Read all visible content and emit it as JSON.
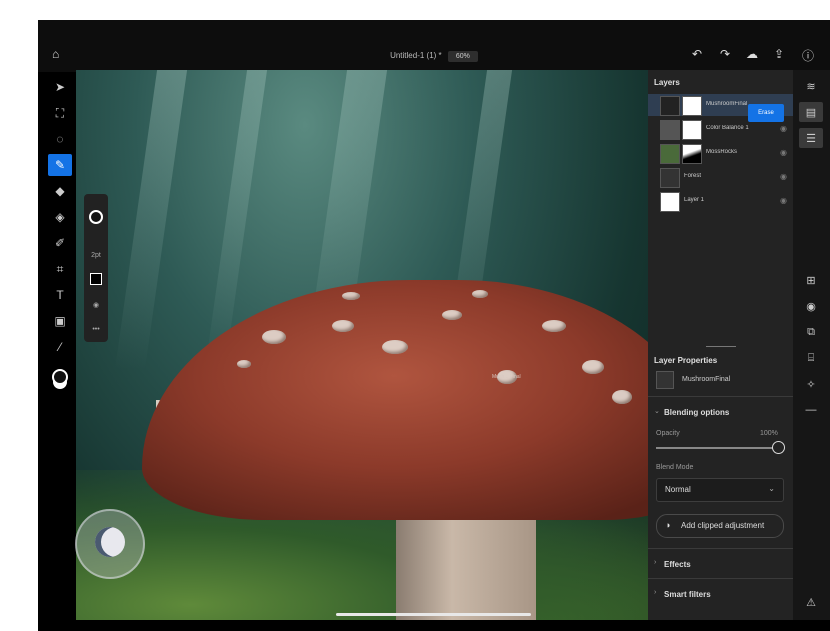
{
  "app": {
    "document_title": "Untitled-1 (1) *",
    "zoom_level": "60%"
  },
  "top_toolbar": {
    "icons": [
      "home-icon",
      "help-icon",
      "undo-icon",
      "redo-icon",
      "cloud-icon",
      "share-icon",
      "info-icon"
    ]
  },
  "left_tools": {
    "icons": [
      "move-icon",
      "crop-select-icon",
      "lasso-icon",
      "brush-icon",
      "eraser-icon",
      "fill-icon",
      "eyedropper-brush-icon",
      "transform-icon",
      "type-icon",
      "image-icon",
      "eyedropper-icon",
      "color-swatch-icon"
    ],
    "active": "brush-icon"
  },
  "brush_panel": {
    "size_label": "2pt",
    "more_label": "•••"
  },
  "layers_panel": {
    "title": "Layers",
    "blend_button_label": "Erase",
    "layers": [
      {
        "name": "MushroomFinal",
        "selected": true
      },
      {
        "name": "Color Balance 1",
        "selected": false
      },
      {
        "name": "MossRocks",
        "selected": false
      },
      {
        "name": "Forest",
        "selected": false
      },
      {
        "name": "Layer 1",
        "selected": false
      }
    ]
  },
  "layer_properties": {
    "title": "Layer Properties",
    "layer_name": "MushroomFinal",
    "blending_section": "Blending options",
    "opacity_label": "Opacity",
    "opacity_value": "100%",
    "opacity_fraction": 1.0,
    "blend_mode_label": "Blend Mode",
    "blend_mode_value": "Normal",
    "clipped_adjustment_label": "Add clipped adjustment",
    "effects_label": "Effects",
    "smart_filters_label": "Smart filters"
  },
  "canvas_overlay_text": "Mush... Final",
  "right_bar": {
    "icons": [
      "layers-stack-icon",
      "layer-properties-icon",
      "adjustments-icon",
      "add-layer-icon",
      "visibility-icon",
      "mask-icon",
      "clip-icon",
      "effects-icon",
      "more-icon",
      "warning-icon"
    ]
  },
  "colors": {
    "accent": "#1473e6",
    "panel_bg": "#232323",
    "toolbar_bg": "#0d0d0d"
  }
}
